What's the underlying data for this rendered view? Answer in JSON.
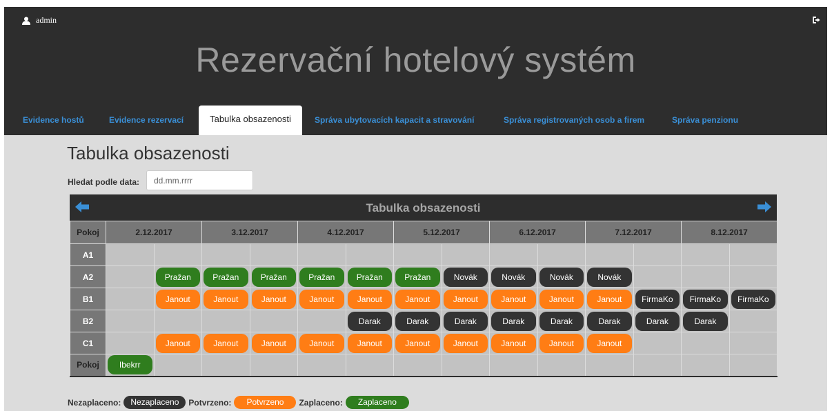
{
  "user": {
    "name": "admin",
    "icon": "user-icon"
  },
  "logout_icon": "logout-icon",
  "title": "Rezervační hotelový systém",
  "tabs": [
    {
      "label": "Evidence hostů",
      "active": false
    },
    {
      "label": "Evidence rezervací",
      "active": false
    },
    {
      "label": "Tabulka obsazenosti",
      "active": true
    },
    {
      "label": "Správa ubytovacích kapacit a stravování",
      "active": false
    },
    {
      "label": "Správa registrovaných osob a firem",
      "active": false
    },
    {
      "label": "Správa penzionu",
      "active": false
    }
  ],
  "page_title": "Tabulka obsazenosti",
  "search": {
    "label": "Hledat podle data:",
    "placeholder": "dd.mm.rrrr",
    "value": ""
  },
  "table": {
    "title": "Tabulka obsazenosti",
    "prev_icon": "arrow-left-icon",
    "next_icon": "arrow-right-icon",
    "room_header": "Pokoj",
    "dates": [
      "2.12.2017",
      "3.12.2017",
      "4.12.2017",
      "5.12.2017",
      "6.12.2017",
      "7.12.2017",
      "8.12.2017"
    ],
    "rows": [
      {
        "room": "A1",
        "cells": [
          null,
          null,
          null,
          null,
          null,
          null,
          null,
          null,
          null,
          null,
          null,
          null,
          null,
          null
        ]
      },
      {
        "room": "A2",
        "cells": [
          null,
          {
            "name": "Pražan",
            "status": "paid"
          },
          {
            "name": "Pražan",
            "status": "paid"
          },
          {
            "name": "Pražan",
            "status": "paid"
          },
          {
            "name": "Pražan",
            "status": "paid"
          },
          {
            "name": "Pražan",
            "status": "paid"
          },
          {
            "name": "Pražan",
            "status": "paid"
          },
          {
            "name": "Novák",
            "status": "unpaid"
          },
          {
            "name": "Novák",
            "status": "unpaid"
          },
          {
            "name": "Novák",
            "status": "unpaid"
          },
          {
            "name": "Novák",
            "status": "unpaid"
          },
          null,
          null,
          null
        ]
      },
      {
        "room": "B1",
        "cells": [
          null,
          {
            "name": "Janout",
            "status": "conf"
          },
          {
            "name": "Janout",
            "status": "conf"
          },
          {
            "name": "Janout",
            "status": "conf"
          },
          {
            "name": "Janout",
            "status": "conf"
          },
          {
            "name": "Janout",
            "status": "conf"
          },
          {
            "name": "Janout",
            "status": "conf"
          },
          {
            "name": "Janout",
            "status": "conf"
          },
          {
            "name": "Janout",
            "status": "conf"
          },
          {
            "name": "Janout",
            "status": "conf"
          },
          {
            "name": "Janout",
            "status": "conf"
          },
          {
            "name": "FirmaKo",
            "status": "unpaid"
          },
          {
            "name": "FirmaKo",
            "status": "unpaid"
          },
          {
            "name": "FirmaKo",
            "status": "unpaid"
          }
        ]
      },
      {
        "room": "B2",
        "cells": [
          null,
          null,
          null,
          null,
          null,
          {
            "name": "Darak",
            "status": "unpaid"
          },
          {
            "name": "Darak",
            "status": "unpaid"
          },
          {
            "name": "Darak",
            "status": "unpaid"
          },
          {
            "name": "Darak",
            "status": "unpaid"
          },
          {
            "name": "Darak",
            "status": "unpaid"
          },
          {
            "name": "Darak",
            "status": "unpaid"
          },
          {
            "name": "Darak",
            "status": "unpaid"
          },
          {
            "name": "Darak",
            "status": "unpaid"
          },
          null
        ]
      },
      {
        "room": "C1",
        "cells": [
          null,
          {
            "name": "Janout",
            "status": "conf"
          },
          {
            "name": "Janout",
            "status": "conf"
          },
          {
            "name": "Janout",
            "status": "conf"
          },
          {
            "name": "Janout",
            "status": "conf"
          },
          {
            "name": "Janout",
            "status": "conf"
          },
          {
            "name": "Janout",
            "status": "conf"
          },
          {
            "name": "Janout",
            "status": "conf"
          },
          {
            "name": "Janout",
            "status": "conf"
          },
          {
            "name": "Janout",
            "status": "conf"
          },
          {
            "name": "Janout",
            "status": "conf"
          },
          null,
          null,
          null
        ]
      },
      {
        "room": "Pokoj",
        "cells": [
          {
            "name": "Ibekrr",
            "status": "paid"
          },
          null,
          null,
          null,
          null,
          null,
          null,
          null,
          null,
          null,
          null,
          null,
          null,
          null
        ]
      }
    ]
  },
  "legend": {
    "unpaid_label": "Nezaplaceno:",
    "unpaid_badge": "Nezaplaceno",
    "conf_label": "Potvrzeno:",
    "conf_badge": "Potvrzeno",
    "paid_label": "Zaplaceno:",
    "paid_badge": "Zaplaceno"
  },
  "colors": {
    "paid": "#2f7d1e",
    "confirmed": "#ff7d14",
    "unpaid": "#333333",
    "header": "#2d2d2d",
    "link": "#3a8fd6"
  }
}
